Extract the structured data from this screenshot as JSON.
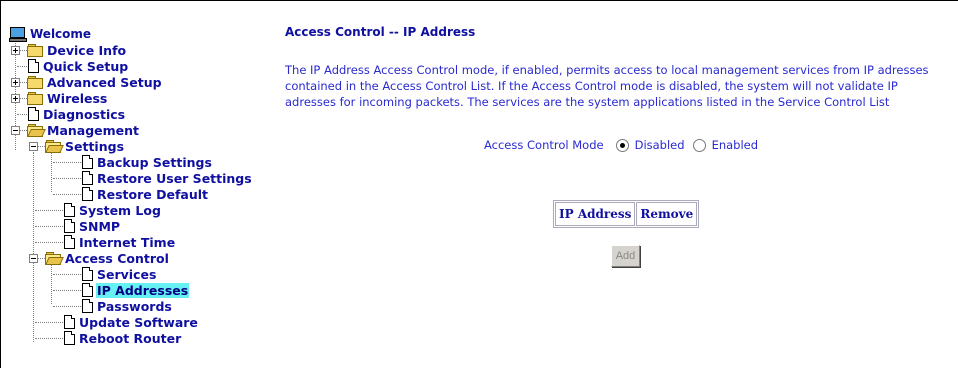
{
  "menu": {
    "root": "Welcome",
    "items": {
      "device_info": "Device Info",
      "quick_setup": "Quick Setup",
      "advanced_setup": "Advanced Setup",
      "wireless": "Wireless",
      "diagnostics": "Diagnostics",
      "management": "Management",
      "settings": "Settings",
      "backup_settings": "Backup Settings",
      "restore_user_settings": "Restore User Settings",
      "restore_default": "Restore Default",
      "system_log": "System Log",
      "snmp": "SNMP",
      "internet_time": "Internet Time",
      "access_control": "Access Control",
      "services": "Services",
      "ip_addresses": "IP Addresses",
      "passwords": "Passwords",
      "update_software": "Update Software",
      "reboot_router": "Reboot Router"
    },
    "selected": "IP Addresses"
  },
  "content": {
    "title": "Access Control -- IP Address",
    "description": "The IP Address Access Control mode, if enabled, permits access to local management services from IP adresses contained in the Access Control List. If the Access Control mode is disabled, the system will not validate IP adresses for incoming packets. The services are the system applications listed in the Service Control List",
    "mode_label": "Access Control Mode",
    "options": {
      "disabled": "Disabled",
      "enabled": "Enabled"
    },
    "selected_mode": "Disabled",
    "table_headers": {
      "ip": "IP Address",
      "remove": "Remove"
    },
    "add_button": "Add"
  },
  "colors": {
    "link": "#1010a0",
    "text": "#2a2ad0",
    "selection": "#66f0f4"
  }
}
